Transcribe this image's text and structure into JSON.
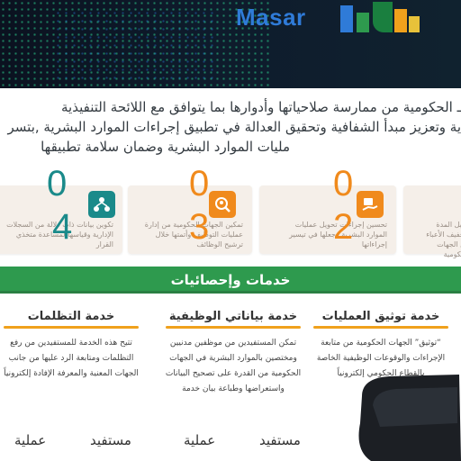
{
  "brand": {
    "name": "Masar",
    "colors": {
      "green": "#2e9a4e",
      "blue": "#2f7bd8",
      "orange": "#f0a11c",
      "teal": "#1a8a8a",
      "dark": "#0b1220"
    }
  },
  "intro": {
    "lines": [
      "ـ الحكومية من ممارسة صلاحياتها وأدوارها بما يتوافق مع اللائحة التنفيذية",
      "ية وتعزيز مبدأ الشفافية وتحقيق العدالة في تطبيق إجراءات الموارد البشرية ,بتسر",
      "مليات الموارد البشرية وضمان سلامة تطبيقها"
    ]
  },
  "stats": [
    {
      "number": "0",
      "number2": "4",
      "text": "تكوين بيانات ذات دلالة من السجلات الإدارية وقياسها لمساعدة متخذي القرار",
      "icon": "network-icon"
    },
    {
      "number": "0",
      "number2": "3",
      "text": "تمكين الجهات الحكومية من إدارة عمليات التوظيف وأتمتها خلال ترشيح الوظائف",
      "icon": "search-user-icon"
    },
    {
      "number": "0",
      "number2": "2",
      "text": "تحسين إجراءات تحويل عمليات الموارد البشرية وجعلها في تيسير إجراءاتها",
      "icon": "hand-icon"
    },
    {
      "text": "تقليل المدة وتخفيف الأعباء عن الجهات الحكومية",
      "icon": "doc-icon"
    }
  ],
  "section": {
    "title": "خدمات وإحصائيات"
  },
  "services": [
    {
      "title": "خدمة توثيق العمليات",
      "desc": "“توثيق” الجهات الحكومية من متابعة الإجراءات والوقوعات الوظيفية الخاصة بالقطاع الحكومي إلكترونياً"
    },
    {
      "title": "خدمة بياناتي الوظيفية",
      "desc": "تمكن المستفيدين من موظفين مدنيين ومختصين بالموارد البشرية في الجهات الحكومية من القدرة على تصحيح البيانات واستعراضها وطباعة بيان خدمة"
    },
    {
      "title": "خدمة التظلمات",
      "desc": "تتيح هذه الخدمة للمستفيدين من رفع التظلمات ومتابعة الرد عليها من جانب الجهات المعنية والمعرفة الإفادة إلكترونياً"
    }
  ],
  "counters": [
    {
      "label": "مستفيد",
      "value": "..."
    },
    {
      "label": "عملية",
      "value": "..."
    },
    {
      "label": "مستفيد",
      "value": "..."
    },
    {
      "label": "عملية",
      "value": "..."
    }
  ]
}
